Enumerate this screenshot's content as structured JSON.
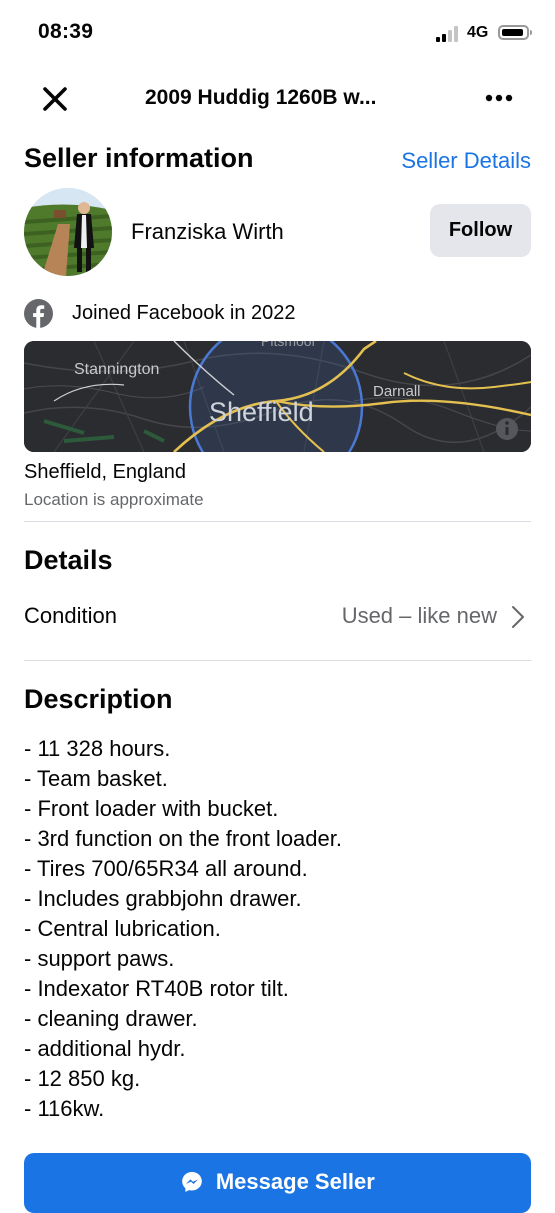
{
  "status_bar": {
    "time": "08:39",
    "network": "4G",
    "signal_bars_active": 2,
    "signal_bars_total": 4,
    "battery_level": 0.9
  },
  "nav": {
    "title": "2009 Huddig 1260B w...",
    "close_icon": "close-icon",
    "more_icon": "more-options-icon"
  },
  "seller": {
    "heading": "Seller information",
    "details_link": "Seller Details",
    "name": "Franziska Wirth",
    "follow_label": "Follow",
    "joined": "Joined Facebook in 2022"
  },
  "map": {
    "labels": {
      "stannington": "Stannington",
      "city": "Sheffield",
      "darnall": "Darnall",
      "north": "Pitsmoor"
    },
    "info_icon": "info-icon"
  },
  "location": {
    "city": "Sheffield, England",
    "note": "Location is approximate"
  },
  "details": {
    "heading": "Details",
    "condition_label": "Condition",
    "condition_value": "Used – like new"
  },
  "description": {
    "heading": "Description",
    "lines": [
      "- 11 328 hours.",
      "- Team basket.",
      "- Front loader with bucket.",
      "- 3rd function on the front loader.",
      "- Tires 700/65R34 all around.",
      "- Includes grabbjohn drawer.",
      "- Central lubrication.",
      "- support paws.",
      "- Indexator RT40B rotor tilt.",
      "- cleaning drawer.",
      "- additional hydr.",
      "- 12 850 kg.",
      "- 116kw."
    ]
  },
  "actions": {
    "message_label": "Message Seller"
  },
  "colors": {
    "accent": "#1b74e4",
    "secondary_text": "#65676b",
    "button_gray": "#e4e6eb",
    "map_bg": "#2b2c30"
  }
}
